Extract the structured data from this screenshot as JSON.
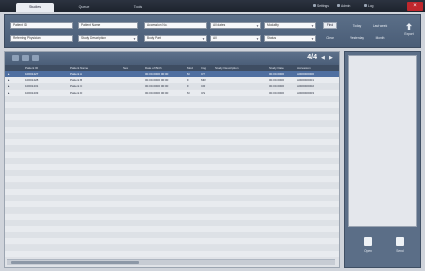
{
  "tabs": [
    "Studies",
    "Queue",
    "Tools"
  ],
  "top_tools": [
    "Settings",
    "Admin",
    "Log"
  ],
  "close_label": "×",
  "search": {
    "fields": [
      {
        "value": "Patient ID"
      },
      {
        "value": "Patient Name"
      },
      {
        "value": "Accession No."
      },
      {
        "value": "All dates"
      },
      {
        "value": "Modality"
      },
      {
        "value": "Referring Physician"
      },
      {
        "value": "Study Description"
      },
      {
        "value": "Body Part"
      },
      {
        "value": "All"
      },
      {
        "value": "Status"
      }
    ],
    "find_label": "Find",
    "clear_label": "Clear",
    "right_top": [
      "Today",
      "Last week"
    ],
    "right_bottom": [
      "Yesterday",
      "Month"
    ],
    "export_label": "Export"
  },
  "list": {
    "count": "4/4",
    "columns": [
      "",
      "Patient ID",
      "Patient Name",
      "Sex",
      "Date of Birth",
      "Mod",
      "Img",
      "Study Description",
      "Study Date",
      "Accession"
    ],
    "rows": [
      [
        "▸",
        "10001427",
        "Patient A",
        "",
        "00.00.0000 00:00",
        "M",
        "CT",
        "",
        "00.00.0000",
        "A000000000"
      ],
      [
        "▸",
        "10001428",
        "Patient B",
        "",
        "00.00.0000 00:00",
        "F",
        "MR",
        "",
        "00.00.0000",
        "A000000001"
      ],
      [
        "▸",
        "10001431",
        "Patient C",
        "",
        "00.00.0000 00:00",
        "F",
        "CR",
        "",
        "00.00.0000",
        "A000000002"
      ],
      [
        "▸",
        "10001433",
        "Patient D",
        "",
        "00.00.0000 00:00",
        "M",
        "US",
        "",
        "00.00.0000",
        "A000000003"
      ]
    ]
  },
  "right_panel": {
    "btn_left": "Open",
    "btn_right": "Send"
  },
  "colors": {
    "accent": "#4f6fa0",
    "panel": "#5b6e87",
    "close": "#c0272d"
  }
}
